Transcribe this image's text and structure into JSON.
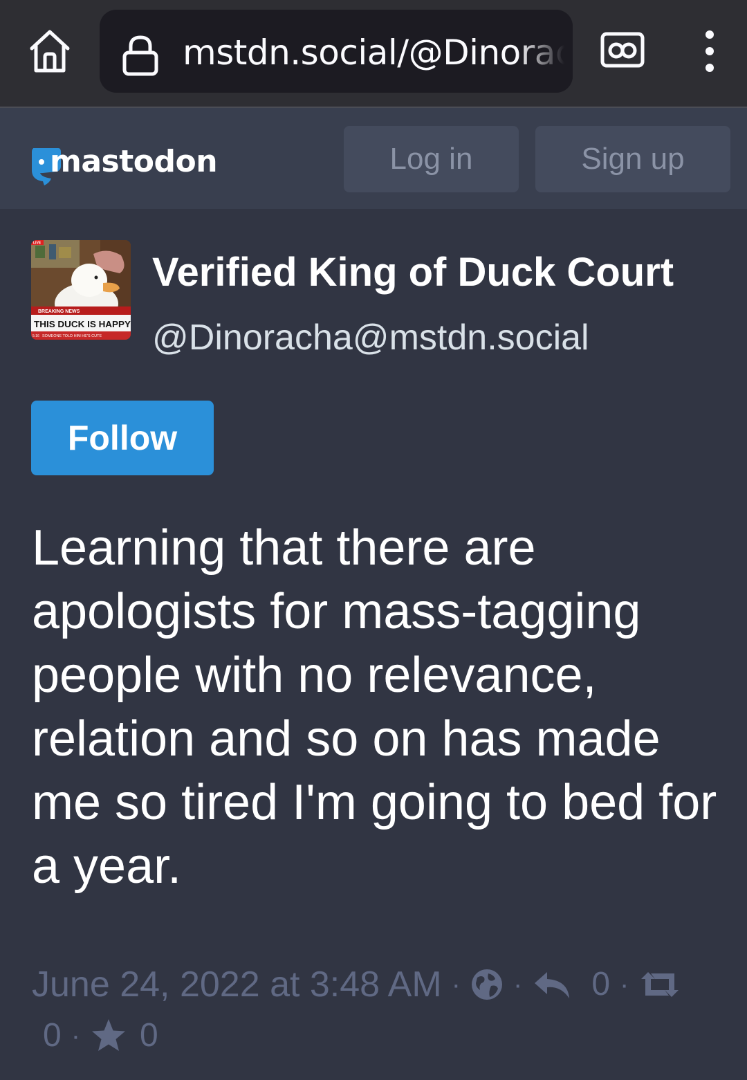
{
  "browser": {
    "url": "mstdn.social/@Dinoracha",
    "home_icon": "home-icon",
    "lock_icon": "lock-icon",
    "reader_icon": "reader-mode-icon",
    "menu_icon": "kebab-menu-icon"
  },
  "header": {
    "logo_text": "mastodon",
    "login_label": "Log in",
    "signup_label": "Sign up"
  },
  "profile": {
    "display_name": "Verified King of Duck Court",
    "handle": "@Dinoracha@mstdn.social",
    "follow_label": "Follow",
    "avatar_caption": {
      "banner": "BREAKING NEWS",
      "headline": "THIS DUCK IS HAPPY",
      "ticker": "SOMEONE TOLD HIM HE'S CUTE",
      "time": "5:16",
      "live": "LIVE"
    }
  },
  "post": {
    "text": "Learning that there are apologists for mass-tagging people with no relevance, relation and so on has made me so tired I'm going to bed for a year.",
    "timestamp": "June 24, 2022 at 3:48 AM",
    "visibility_icon": "globe-icon",
    "replies": "0",
    "boosts": "0",
    "favourites": "0"
  },
  "colors": {
    "background": "#313543",
    "header": "#393f4f",
    "browser_bar": "#2e2e33",
    "accent": "#2b90d9",
    "muted": "#606984"
  }
}
